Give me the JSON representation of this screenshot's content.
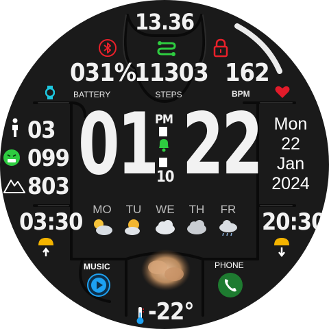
{
  "top_time": "13.36",
  "battery": {
    "value": "031%",
    "label": "BATTERY"
  },
  "steps": {
    "value": "11303",
    "label": "STEPS"
  },
  "heart": {
    "value": "162",
    "label": "BPM"
  },
  "left_stats": {
    "stat1": "03",
    "stat2": "099",
    "stat3": "803"
  },
  "time": {
    "hours": "01",
    "minutes": "22",
    "ampm": "PM",
    "seconds": "10"
  },
  "date": {
    "weekday": "Mon",
    "day": "22",
    "month": "Jan",
    "year": "2024"
  },
  "forecast": [
    {
      "day": "MO",
      "icon": "sun-cloud-icon"
    },
    {
      "day": "TU",
      "icon": "sun-cloud-icon"
    },
    {
      "day": "WE",
      "icon": "cloud-icon"
    },
    {
      "day": "TH",
      "icon": "cloud-icon"
    },
    {
      "day": "FR",
      "icon": "rain-cloud-icon"
    }
  ],
  "sunrise": "03:30",
  "sunset": "20:30",
  "music_label": "MUSIC",
  "phone_label": "PHONE",
  "temperature": "-22°",
  "colors": {
    "accent_green": "#2ecc40",
    "bluetooth_red": "#e8202a",
    "music_blue": "#1da1f2",
    "phone_green": "#28a745",
    "heart_red": "#e21b2a"
  }
}
